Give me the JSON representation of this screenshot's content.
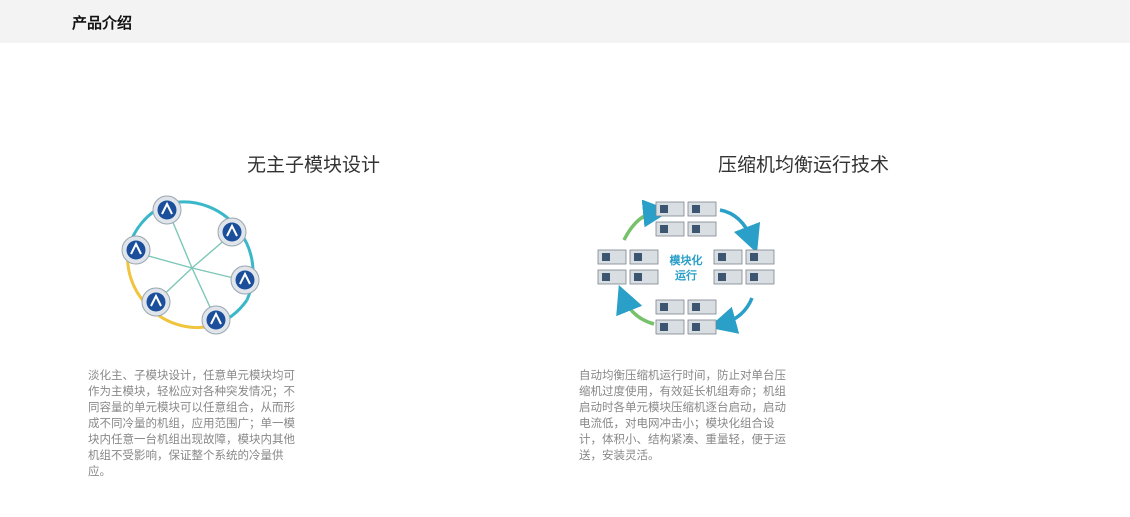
{
  "header": {
    "title": "产品介绍"
  },
  "features": [
    {
      "title": "无主子模块设计",
      "description": "淡化主、子模块设计，任意单元模块均可作为主模块，轻松应对各种突发情况；不同容量的单元模块可以任意组合，从而形成不同冷量的机组，应用范围广；单一模块内任意一台机组出现故障，模块内其他机组不受影响，保证整个系统的冷量供应。",
      "figure_icon": "module-ring-diagram"
    },
    {
      "title": "压缩机均衡运行技术",
      "description": "自动均衡压缩机运行时间，防止对单台压缩机过度使用，有效延长机组寿命；机组启动时各单元模块压缩机逐台启动，启动电流低，对电网冲击小；模块化组合设计，体积小、结构紧凑、重量轻，便于运送，安装灵活。",
      "figure_icon": "module-rotation-diagram",
      "center_label_line1": "模块化",
      "center_label_line2": "运行"
    }
  ],
  "colors": {
    "header_bg": "#f3f3f3",
    "accent_blue": "#1b4f9c",
    "ring_teal": "#3ab7c9",
    "ring_yellow": "#f0c43c",
    "arrow_green": "#76c16a"
  }
}
